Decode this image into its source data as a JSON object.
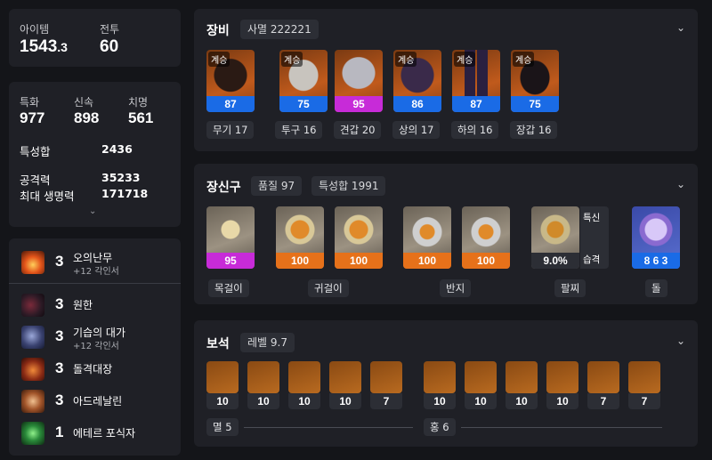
{
  "summary": {
    "item_level_label": "아이템",
    "item_level": "1543",
    "item_level_frac": ".3",
    "combat_label": "전투",
    "combat": "60"
  },
  "stats": {
    "spec_label": "특화",
    "spec": "977",
    "swift_label": "신속",
    "swift": "898",
    "crit_label": "치명",
    "crit": "561",
    "total_label": "특성합",
    "total": "2436",
    "atk_label": "공격력",
    "atk": "35233",
    "hp_label": "최대 생명력",
    "hp": "171718"
  },
  "engravings": [
    {
      "level": "3",
      "name": "오의난무",
      "sub": "+12 각인서",
      "icon": "flame-burst-icon"
    },
    {
      "level": "3",
      "name": "원한",
      "sub": "",
      "icon": "dark-wolf-icon"
    },
    {
      "level": "3",
      "name": "기습의 대가",
      "sub": "+12 각인서",
      "icon": "crescent-moon-icon"
    },
    {
      "level": "3",
      "name": "돌격대장",
      "sub": "",
      "icon": "charge-fire-icon"
    },
    {
      "level": "3",
      "name": "아드레날린",
      "sub": "",
      "icon": "adrenaline-fist-icon"
    },
    {
      "level": "1",
      "name": "에테르 포식자",
      "sub": "",
      "icon": "ether-orb-icon"
    }
  ],
  "equipment": {
    "title": "장비",
    "set_tag": "사멸 222221",
    "items": [
      {
        "badge": "계승",
        "quality": "87",
        "label": "무기 17",
        "color": "#1a6be6"
      },
      {
        "badge": "계승",
        "quality": "75",
        "label": "투구 16",
        "color": "#1a6be6"
      },
      {
        "badge": "",
        "quality": "95",
        "label": "견갑 20",
        "color": "#c72bd8"
      },
      {
        "badge": "계승",
        "quality": "86",
        "label": "상의 17",
        "color": "#1a6be6"
      },
      {
        "badge": "계승",
        "quality": "87",
        "label": "하의 16",
        "color": "#1a6be6"
      },
      {
        "badge": "계승",
        "quality": "75",
        "label": "장갑 16",
        "color": "#1a6be6"
      }
    ]
  },
  "accessories": {
    "title": "장신구",
    "quality_tag": "품질 97",
    "stat_tag": "특성합 1991",
    "items": [
      {
        "quality": "95",
        "color": "#c72bd8"
      },
      {
        "quality": "100",
        "color": "#e6711a"
      },
      {
        "quality": "100",
        "color": "#e6711a"
      },
      {
        "quality": "100",
        "color": "#e6711a"
      },
      {
        "quality": "100",
        "color": "#e6711a"
      }
    ],
    "labels": {
      "necklace": "목걸이",
      "earring": "귀걸이",
      "ring": "반지",
      "bracelet": "팔찌",
      "stone": "돌"
    },
    "bracelet": {
      "value": "9.0%",
      "stat1": "특신",
      "stat2": "습격"
    },
    "stone": {
      "value": "8 6 3"
    }
  },
  "gems": {
    "title": "보석",
    "level_tag": "레벨 9.7",
    "group1": {
      "label": "멸 5",
      "values": [
        "10",
        "10",
        "10",
        "10",
        "7"
      ]
    },
    "group2": {
      "label": "홍 6",
      "values": [
        "10",
        "10",
        "10",
        "10",
        "7",
        "7"
      ]
    }
  }
}
